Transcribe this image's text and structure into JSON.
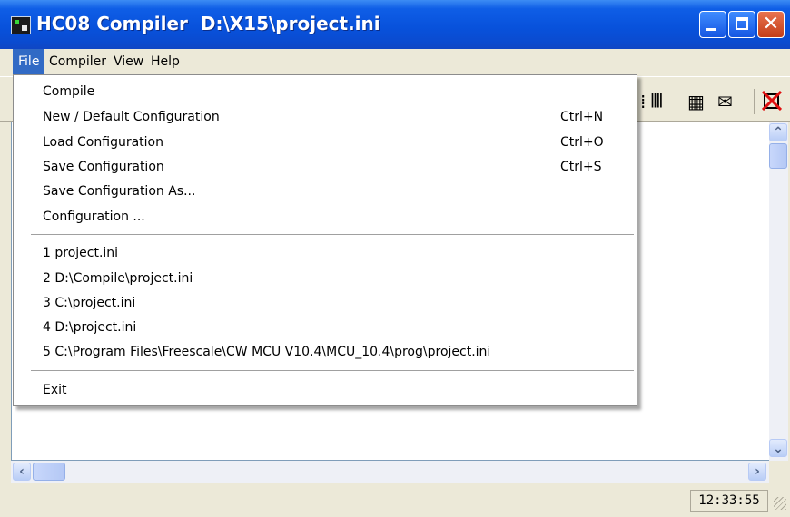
{
  "window": {
    "title": "HC08 Compiler  D:\\X15\\project.ini"
  },
  "menubar": {
    "items": [
      "File",
      "Compiler",
      "View",
      "Help"
    ]
  },
  "file_menu": {
    "items": [
      {
        "label": "Compile",
        "shortcut": ""
      },
      {
        "label": "New / Default Configuration",
        "shortcut": "Ctrl+N"
      },
      {
        "label": "Load Configuration",
        "shortcut": "Ctrl+O"
      },
      {
        "label": "Save Configuration",
        "shortcut": "Ctrl+S"
      },
      {
        "label": "Save Configuration As...",
        "shortcut": ""
      },
      {
        "label": "Configuration ...",
        "shortcut": ""
      }
    ],
    "recent": [
      "1 project.ini",
      "2 D:\\Compile\\project.ini",
      "3 C:\\project.ini",
      "4 D:\\project.ini",
      "5 C:\\Program Files\\Freescale\\CW MCU V10.4\\MCU_10.4\\prog\\project.ini"
    ],
    "exit": "Exit"
  },
  "toolbar": {
    "icons": [
      "options-icon",
      "bits-icon",
      "settings-icon",
      "message-icon",
      "stop-icon"
    ]
  },
  "statusbar": {
    "time": "12:33:55"
  },
  "colors": {
    "title_blue": "#0852dc",
    "menu_highlight": "#316ac5",
    "close_red": "#c33d18"
  }
}
